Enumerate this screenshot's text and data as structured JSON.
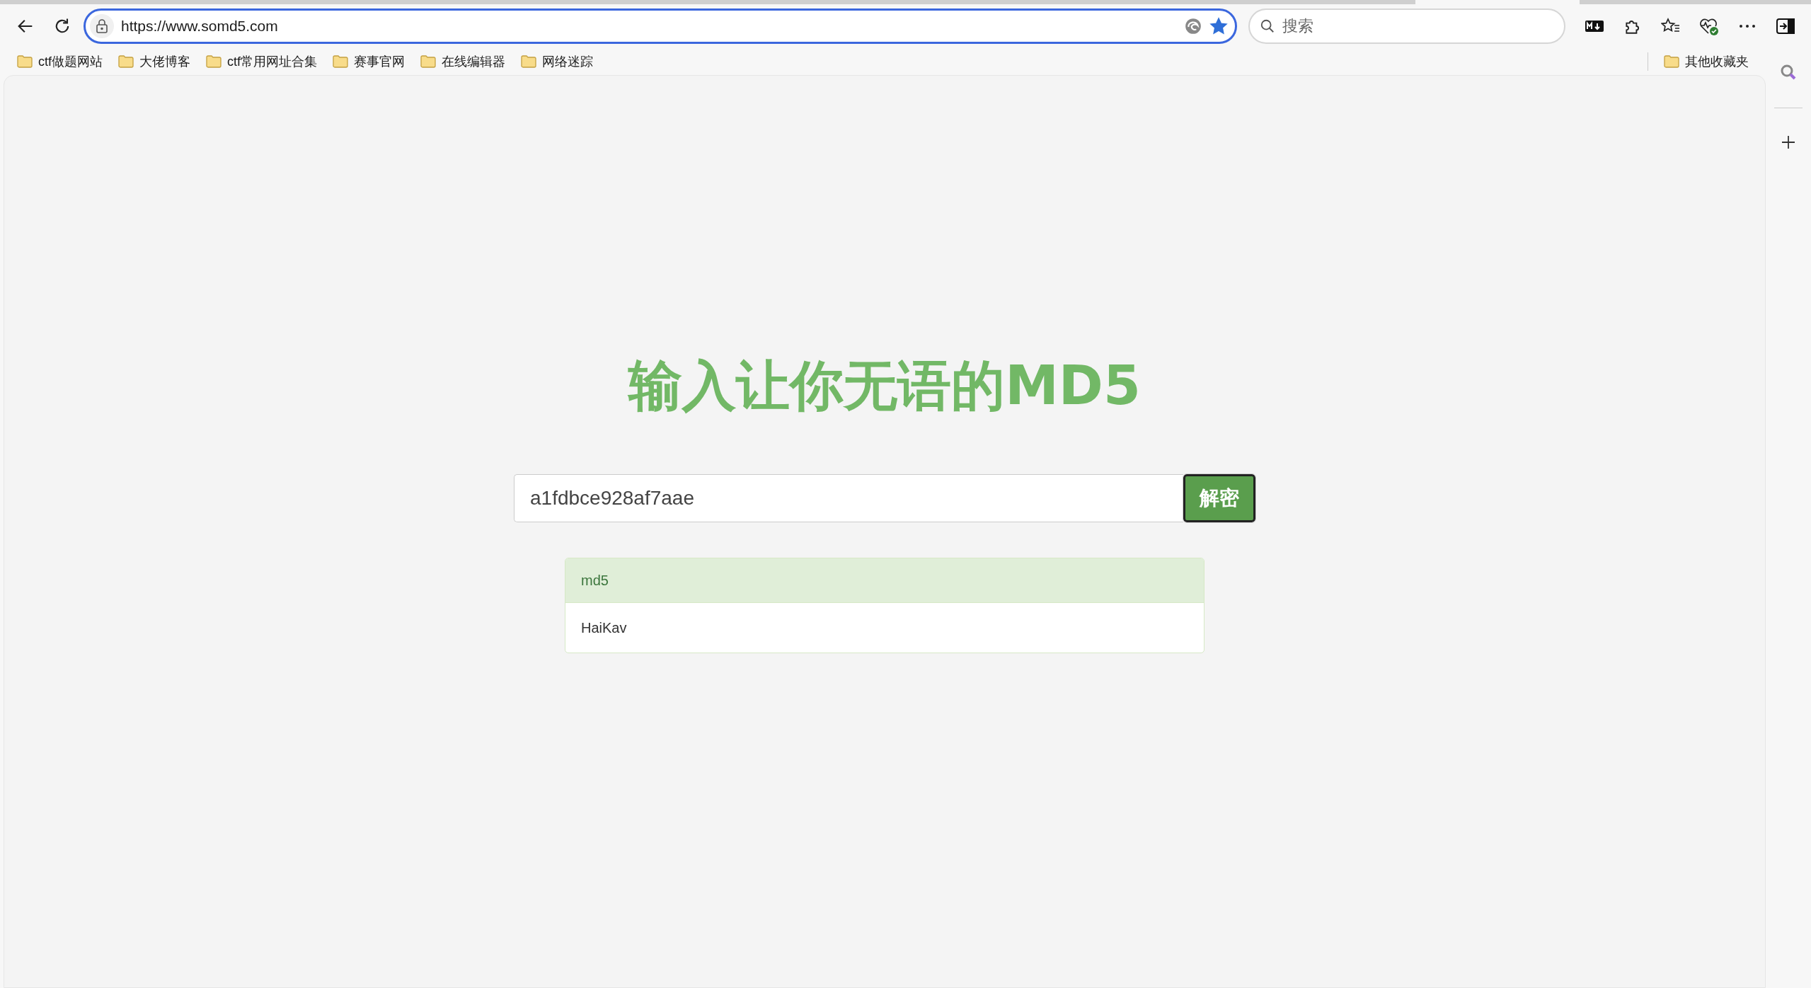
{
  "browser": {
    "url": "https://www.somd5.com",
    "search": {
      "placeholder": "搜索"
    },
    "favorite": true
  },
  "bookmarks": [
    {
      "label": "ctf做题网站"
    },
    {
      "label": "大佬博客"
    },
    {
      "label": "ctf常用网址合集"
    },
    {
      "label": "赛事官网"
    },
    {
      "label": "在线编辑器"
    },
    {
      "label": "网络迷踪"
    }
  ],
  "other_bookmarks": {
    "label": "其他收藏夹"
  },
  "page": {
    "heading": "输入让你无语的MD5",
    "hash_input": {
      "value": "a1fdbce928af7aae"
    },
    "decrypt_button": "解密",
    "result": {
      "heading": "md5",
      "body": "HaiKav"
    }
  }
}
